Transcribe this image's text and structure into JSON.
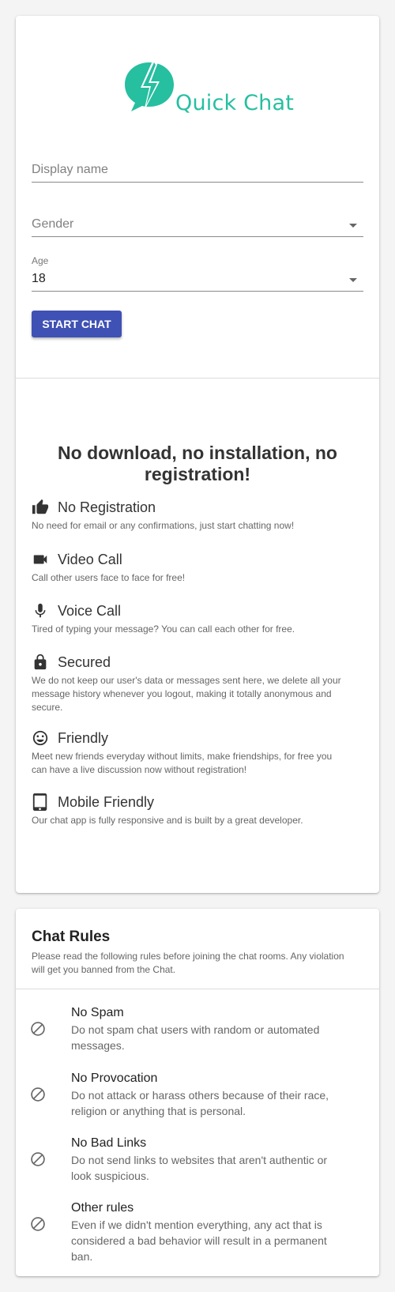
{
  "brand": {
    "name": "Quick Chat",
    "color": "#26bfa0"
  },
  "form": {
    "display_name": {
      "placeholder": "Display name",
      "value": ""
    },
    "gender": {
      "placeholder": "Gender",
      "value": ""
    },
    "age": {
      "label": "Age",
      "value": "18"
    },
    "start_button": "START CHAT",
    "button_color": "#3f51b5"
  },
  "tagline": "No download, no installation, no registration!",
  "features": [
    {
      "icon": "thumbs-up-icon",
      "title": "No Registration",
      "description": "No need for email or any confirmations, just start chatting now!"
    },
    {
      "icon": "video-camera-icon",
      "title": "Video Call",
      "description": "Call other users face to face for free!"
    },
    {
      "icon": "microphone-icon",
      "title": "Voice Call",
      "description": "Tired of typing your message? You can call each other for free."
    },
    {
      "icon": "lock-icon",
      "title": "Secured",
      "description": "We do not keep our user's data or messages sent here, we delete all your message history whenever you logout, making it totally anonymous and secure."
    },
    {
      "icon": "smiley-icon",
      "title": "Friendly",
      "description": "Meet new friends everyday without limits, make friendships, for free you can have a live discussion now without registration!"
    },
    {
      "icon": "tablet-icon",
      "title": "Mobile Friendly",
      "description": "Our chat app is fully responsive and is built by a great developer."
    }
  ],
  "rules": {
    "title": "Chat Rules",
    "intro": "Please read the following rules before joining the chat rooms. Any violation will get you banned from the Chat.",
    "items": [
      {
        "icon": "block-icon",
        "title": "No Spam",
        "description": "Do not spam chat users with random or automated messages."
      },
      {
        "icon": "block-icon",
        "title": "No Provocation",
        "description": "Do not attack or harass others because of their race, religion or anything that is personal."
      },
      {
        "icon": "block-icon",
        "title": "No Bad Links",
        "description": "Do not send links to websites that aren't authentic or look suspicious."
      },
      {
        "icon": "block-icon",
        "title": "Other rules",
        "description": "Even if we didn't mention everything, any act that is considered a bad behavior will result in a permanent ban."
      }
    ]
  }
}
